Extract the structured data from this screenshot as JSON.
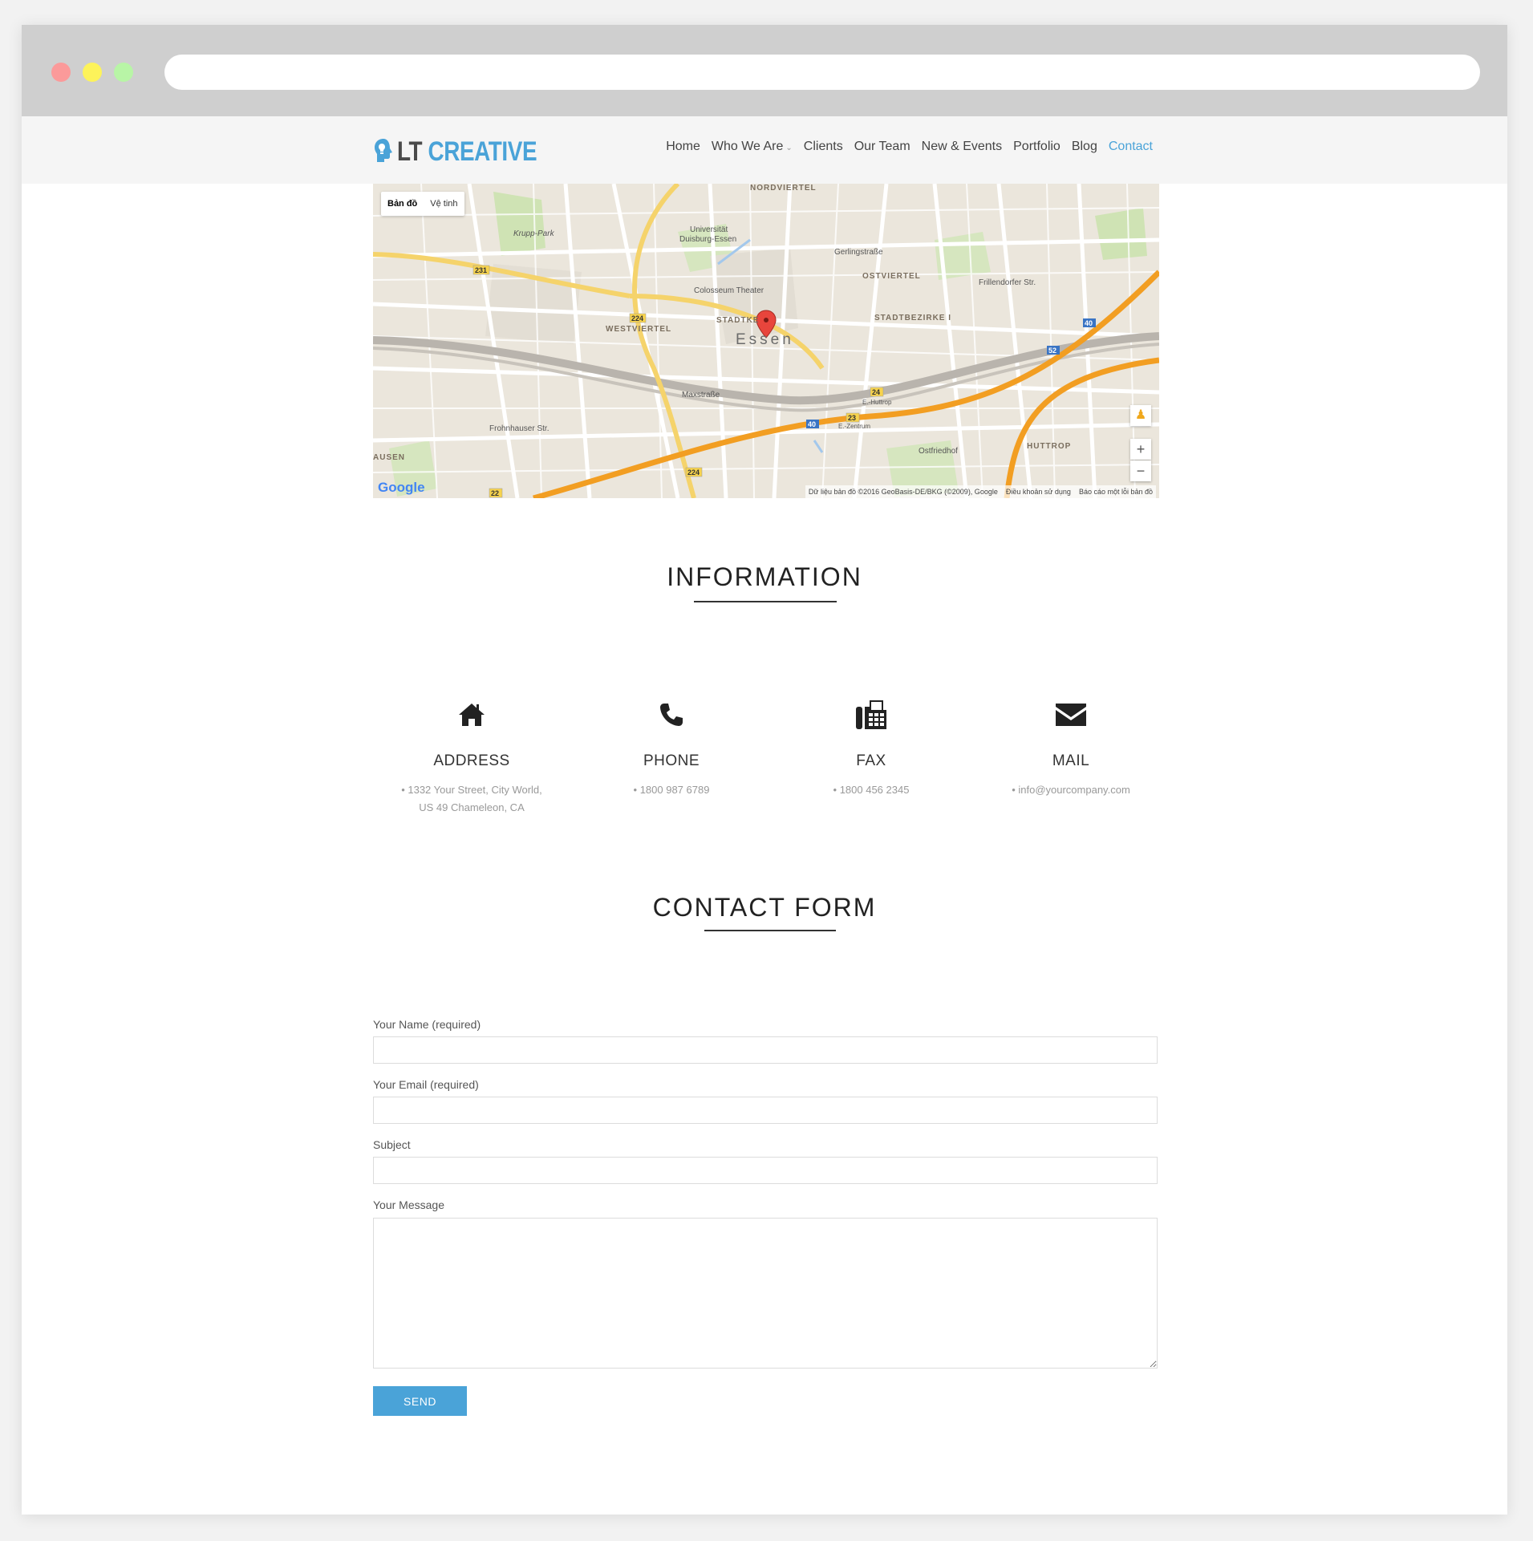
{
  "brand": {
    "name_part1": "LT",
    "name_part2": "CREATIVE",
    "accent": "#4aa3d8"
  },
  "nav": [
    {
      "label": "Home",
      "active": false
    },
    {
      "label": "Who We Are",
      "active": false,
      "dropdown": true
    },
    {
      "label": "Clients",
      "active": false
    },
    {
      "label": "Our Team",
      "active": false
    },
    {
      "label": "New & Events",
      "active": false
    },
    {
      "label": "Portfolio",
      "active": false
    },
    {
      "label": "Blog",
      "active": false
    },
    {
      "label": "Contact",
      "active": true
    }
  ],
  "map": {
    "type_map": "Bản đồ",
    "type_satellite": "Vệ tinh",
    "city": "Essen",
    "labels": {
      "nordviertel": "NORDVIERTEL",
      "university": "Universität",
      "university2": "Duisburg-Essen",
      "krupp": "Krupp-Park",
      "colosseum": "Colosseum Theater",
      "westviertel": "WESTVIERTEL",
      "ostviertel": "OSTVIERTEL",
      "stadtbezirke": "STADTBEZIRKE I",
      "stadtkern": "STADTKE",
      "gerlingstrasse": "Gerlingstraße",
      "frillendorfer": "Frillendorfer Str.",
      "maxstrasse": "Maxstraße",
      "huttrop": "HUTTROP",
      "ostfriedhof": "Ostfriedhof",
      "hollestrasse": "E.-Huttrop",
      "zentrum": "E.-Zentrum",
      "ausen": "AUSEN",
      "frohnhauser": "Frohnhauser Str."
    },
    "road_shields": [
      "231",
      "224",
      "40",
      "52",
      "24",
      "23",
      "40",
      "224",
      "22"
    ],
    "google_logo": "Google",
    "attribution": "Dữ liệu bản đồ ©2016 GeoBasis-DE/BKG (©2009), Google",
    "terms": "Điều khoản sử dụng",
    "report": "Báo cáo một lỗi bản đồ",
    "zoom_in": "+",
    "zoom_out": "−"
  },
  "information": {
    "title": "INFORMATION",
    "items": [
      {
        "icon": "home-icon",
        "title": "ADDRESS",
        "line1": "• 1332 Your Street, City World,",
        "line2": "US 49 Chameleon, CA"
      },
      {
        "icon": "phone-icon",
        "title": "PHONE",
        "line1": "• 1800 987 6789",
        "line2": ""
      },
      {
        "icon": "fax-icon",
        "title": "FAX",
        "line1": "• 1800 456 2345",
        "line2": ""
      },
      {
        "icon": "mail-icon",
        "title": "MAIL",
        "line1": "• info@yourcompany.com",
        "line2": ""
      }
    ]
  },
  "contact_form": {
    "title": "CONTACT FORM",
    "name_label": "Your Name (required)",
    "email_label": "Your Email (required)",
    "subject_label": "Subject",
    "message_label": "Your Message",
    "name_value": "",
    "email_value": "",
    "subject_value": "",
    "message_value": "",
    "send_label": "SEND"
  }
}
